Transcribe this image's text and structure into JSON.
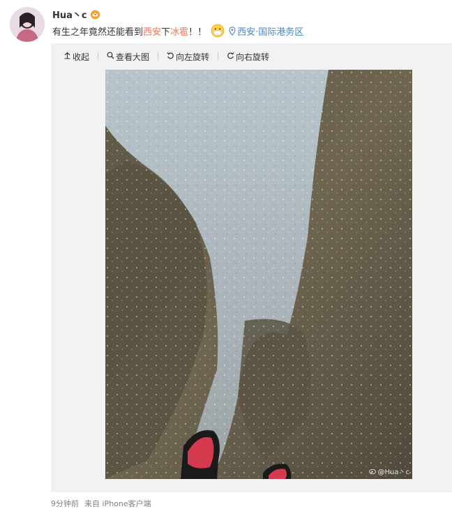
{
  "user": {
    "name": "Hua丶c",
    "badge_icon": "crown-icon"
  },
  "post": {
    "text_part1": "有生之年竟然还能看到",
    "topic1": "西安",
    "text_part2": "下",
    "topic2": "冰雹",
    "text_part3": "！！",
    "emoji": "mask-face-emoji",
    "location": "西安·国际港务区"
  },
  "toolbar": {
    "collapse": "收起",
    "view_large": "查看大图",
    "rotate_left": "向左旋转",
    "rotate_right": "向右旋转"
  },
  "photo": {
    "watermark": "@Hua丶c"
  },
  "footer": {
    "time": "9分钟前",
    "source_prefix": "来自",
    "source": "iPhone客户端"
  },
  "colors": {
    "link": "#eb7350",
    "location": "#4a86c5",
    "panel_bg": "#f2f2f5"
  }
}
